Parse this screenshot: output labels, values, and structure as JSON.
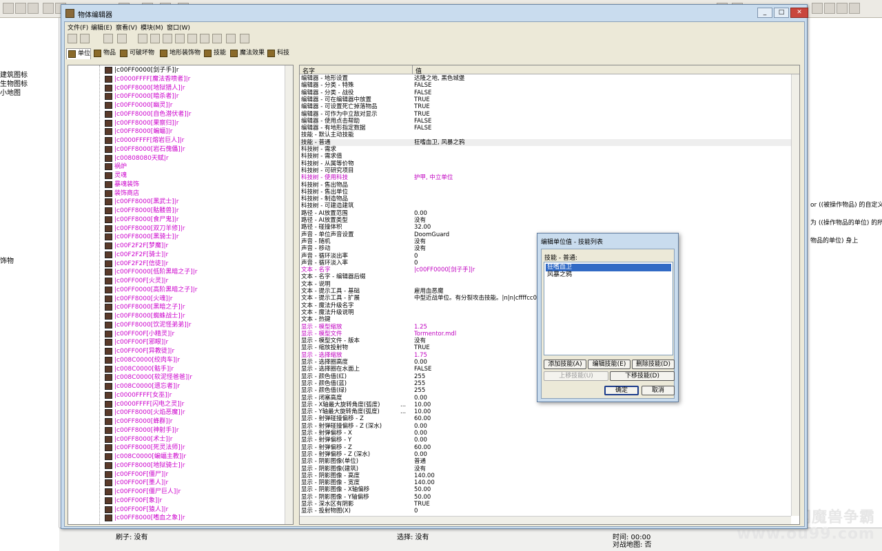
{
  "window": {
    "title": "物体编辑器"
  },
  "menu": [
    "文件(F)",
    "编辑(E)",
    "察看(V)",
    "模块(M)",
    "窗口(W)"
  ],
  "tabs": [
    "单位",
    "物品",
    "可破坏物",
    "地形装饰物",
    "技能",
    "魔法效果",
    "科技"
  ],
  "background": {
    "left_texts": [
      "建筑图标",
      "生物图标",
      "小地图",
      "饰物"
    ],
    "right_texts": [
      "or ((被操作物品) 的自定义",
      "为 ((操作物品的单位) 的所",
      "物品的单位) 身上"
    ],
    "status": {
      "brush": "刷子: 没有",
      "select": "选择: 没有",
      "time": "时间: 00:00",
      "map": "对战地图: 否"
    }
  },
  "watermark": {
    "line1": "偶久网魔兽争霸",
    "line2": "www.ou99.com"
  },
  "tree": [
    {
      "label": "|c00FF0000[剑子手]|r",
      "color": "#000000"
    },
    {
      "label": "|c0000FFFF[魔法香喷者]|r",
      "color": "#cc00cc"
    },
    {
      "label": "|c00FF8000[地狱猎人]|r",
      "color": "#cc00cc"
    },
    {
      "label": "|c00FF0000[暗杀者]|r",
      "color": "#cc00cc"
    },
    {
      "label": "|c00FF0000[幽灵]|r",
      "color": "#cc00cc"
    },
    {
      "label": "|c00FF8000[自色潜伏者]|r",
      "color": "#cc00cc"
    },
    {
      "label": "|c00FF8000[果察归]|r",
      "color": "#cc00cc"
    },
    {
      "label": "|c00FF8000[蝙蝠]|r",
      "color": "#cc00cc"
    },
    {
      "label": "|c0000FFFF[熔岩巨人]|r",
      "color": "#cc00cc"
    },
    {
      "label": "|c00FF8000[岩石傀儡]|r",
      "color": "#cc00cc"
    },
    {
      "label": "|c00808080天赋|r",
      "color": "#cc00cc"
    },
    {
      "label": "祸炉",
      "color": "#cc00cc"
    },
    {
      "label": "灵魂",
      "color": "#cc00cc"
    },
    {
      "label": "暴魂装饰",
      "color": "#cc00cc"
    },
    {
      "label": "装饰商店",
      "color": "#cc00cc"
    },
    {
      "label": "|c00FF8000[黑武士]|r",
      "color": "#cc00cc"
    },
    {
      "label": "|c00FF8000[骷髅兽]|r",
      "color": "#cc00cc"
    },
    {
      "label": "|c00FF8000[食尸鬼]|r",
      "color": "#cc00cc"
    },
    {
      "label": "|c00FF8000[双刀羊修]|r",
      "color": "#cc00cc"
    },
    {
      "label": "|c00FF8000[黑骑士]|r",
      "color": "#cc00cc"
    },
    {
      "label": "|c00F2F2F[梦魔]|r",
      "color": "#cc00cc"
    },
    {
      "label": "|c00F2F2F[骑士]|r",
      "color": "#cc00cc"
    },
    {
      "label": "|c00F2F2F[信徒]|r",
      "color": "#cc00cc"
    },
    {
      "label": "|c00FF0000[低阶黑暗之子]|r",
      "color": "#cc00cc"
    },
    {
      "label": "|c00FF00F[火灵]|r",
      "color": "#cc00cc"
    },
    {
      "label": "|c00FF0000[高阶黑暗之子]|r",
      "color": "#cc00cc"
    },
    {
      "label": "|c00FF8000[火魂]|r",
      "color": "#cc00cc"
    },
    {
      "label": "|c00FF8000[黑暗之子]|r",
      "color": "#cc00cc"
    },
    {
      "label": "|c00FF8000[蜘蛛战士]|r",
      "color": "#cc00cc"
    },
    {
      "label": "|c00FF8000[饮泥怪弟弟]|r",
      "color": "#cc00cc"
    },
    {
      "label": "|c00FF00F[小精灵]|r",
      "color": "#cc00cc"
    },
    {
      "label": "|c00FF00F[邪眼]|r",
      "color": "#cc00cc"
    },
    {
      "label": "|c00FF00F[异教徒]|r",
      "color": "#cc00cc"
    },
    {
      "label": "|c008C0000[绞肉车]|r",
      "color": "#cc00cc"
    },
    {
      "label": "|c008C0000[骷手]|r",
      "color": "#cc00cc"
    },
    {
      "label": "|c008C0000[软泥怪爸爸]|r",
      "color": "#cc00cc"
    },
    {
      "label": "|c008C0000[遗忘者]|r",
      "color": "#cc00cc"
    },
    {
      "label": "|c0000FFFF[女巫]|r",
      "color": "#cc00cc"
    },
    {
      "label": "|c0000FFFF[闪电之灵]|r",
      "color": "#cc00cc"
    },
    {
      "label": "|c00FF8000[火焰恶魔]|r",
      "color": "#cc00cc"
    },
    {
      "label": "|c00FF8000[蜂群]|r",
      "color": "#cc00cc"
    },
    {
      "label": "|c00FF8000[神射手]|r",
      "color": "#cc00cc"
    },
    {
      "label": "|c00FF8000[术士]|r",
      "color": "#cc00cc"
    },
    {
      "label": "|c00FF8000[死灵法师]|r",
      "color": "#cc00cc"
    },
    {
      "label": "|c008C0000[蝙蝠主教]|r",
      "color": "#cc00cc"
    },
    {
      "label": "|c00FF8000[地狱骑士]|r",
      "color": "#cc00cc"
    },
    {
      "label": "|c00FF00F[僵尸]|r",
      "color": "#cc00cc"
    },
    {
      "label": "|c00FF00F[墨人]|r",
      "color": "#cc00cc"
    },
    {
      "label": "|c00FF00F[僵尸巨人]|r",
      "color": "#cc00cc"
    },
    {
      "label": "|c00FF00F[象]|r",
      "color": "#cc00cc"
    },
    {
      "label": "|c00FF00F[猿人]|r",
      "color": "#cc00cc"
    },
    {
      "label": "|c00FF8000[嗜血之象]|r",
      "color": "#cc00cc"
    }
  ],
  "grid": {
    "col_name": "名字",
    "col_value": "值",
    "rows": [
      {
        "k": "编辑器 - 地形设置",
        "v": "达隆之地, 黑色城堡"
      },
      {
        "k": "编辑器 - 分类 - 特殊",
        "v": "FALSE"
      },
      {
        "k": "编辑器 - 分类 - 战役",
        "v": "FALSE"
      },
      {
        "k": "编辑器 - 可在编辑器中放置",
        "v": "TRUE"
      },
      {
        "k": "编辑器 - 可设置死亡掉落物品",
        "v": "TRUE"
      },
      {
        "k": "编辑器 - 可作为中立敌对显示",
        "v": "TRUE"
      },
      {
        "k": "编辑器 - 使用点击帮助",
        "v": "FALSE"
      },
      {
        "k": "编辑器 - 有地形指定数据",
        "v": "FALSE"
      },
      {
        "k": "技能 - 默认主动技能",
        "v": ""
      },
      {
        "k": "技能 - 普通",
        "v": "狂嗜血卫, 风暴之鸦",
        "hl": true
      },
      {
        "k": "科技树 - 需求",
        "v": ""
      },
      {
        "k": "科技树 - 需求值",
        "v": ""
      },
      {
        "k": "科技树 - 从属等价物",
        "v": ""
      },
      {
        "k": "科技树 - 可研究项目",
        "v": ""
      },
      {
        "k": "科技树 - 使用科技",
        "v": "护甲, 中立单位",
        "mag": true
      },
      {
        "k": "科技树 - 售出物品",
        "v": ""
      },
      {
        "k": "科技树 - 售出单位",
        "v": ""
      },
      {
        "k": "科技树 - 制造物品",
        "v": ""
      },
      {
        "k": "科技树 - 可建造建筑",
        "v": ""
      },
      {
        "k": "路径 - AI放置范围",
        "v": "0.00"
      },
      {
        "k": "路径 - AI放置类型",
        "v": "没有"
      },
      {
        "k": "路径 - 碰撞体积",
        "v": "32.00"
      },
      {
        "k": "声音 - 单位声音设置",
        "v": "DoomGuard"
      },
      {
        "k": "声音 - 随机",
        "v": "没有"
      },
      {
        "k": "声音 - 移动",
        "v": "没有"
      },
      {
        "k": "声音 - 循环淡出率",
        "v": "0"
      },
      {
        "k": "声音 - 循环淡入率",
        "v": "0"
      },
      {
        "k": "文本 - 名字",
        "v": "|c00FF0000[剑子手]|r",
        "mag": true
      },
      {
        "k": "文本 - 名字 - 编辑器后缀",
        "v": ""
      },
      {
        "k": "文本 - 说明",
        "v": ""
      },
      {
        "k": "文本 - 提示工具 - 基础",
        "v": "雇用血恶魔"
      },
      {
        "k": "文本 - 提示工具 - 扩展",
        "v": "中型近战单位。有分裂攻击技能。|n|n|cffffcc00"
      },
      {
        "k": "文本 - 魔法升级名字",
        "v": ""
      },
      {
        "k": "文本 - 魔法升级说明",
        "v": ""
      },
      {
        "k": "文本 - 热键",
        "v": ""
      },
      {
        "k": "显示 - 模型缩放",
        "v": "1.25",
        "mag": true
      },
      {
        "k": "显示 - 模型文件",
        "v": "Tormentor.mdl",
        "mag": true
      },
      {
        "k": "显示 - 模型文件 - 版本",
        "v": "没有"
      },
      {
        "k": "显示 - 缩放投射物",
        "v": "TRUE"
      },
      {
        "k": "显示 - 选择缩放",
        "v": "1.75",
        "mag": true
      },
      {
        "k": "显示 - 选择圈高度",
        "v": "0.00"
      },
      {
        "k": "显示 - 选择圈在水面上",
        "v": "FALSE"
      },
      {
        "k": "显示 - 颜色值(红)",
        "v": "255"
      },
      {
        "k": "显示 - 颜色值(蓝)",
        "v": "255"
      },
      {
        "k": "显示 - 颜色值(绿)",
        "v": "255"
      },
      {
        "k": "显示 - 闭塞高度",
        "v": "0.00"
      },
      {
        "k": "显示 - X轴最大旋转角度(弧度)",
        "v": "10.00",
        "dots": true
      },
      {
        "k": "显示 - Y轴最大旋转角度(弧度)",
        "v": "10.00",
        "dots": true
      },
      {
        "k": "显示 - 射弹碰撞偏移 - Z",
        "v": "60.00"
      },
      {
        "k": "显示 - 射弹碰撞偏移 - Z (深水)",
        "v": "0.00"
      },
      {
        "k": "显示 - 射弹偏移 - X",
        "v": "0.00"
      },
      {
        "k": "显示 - 射弹偏移 - Y",
        "v": "0.00"
      },
      {
        "k": "显示 - 射弹偏移 - Z",
        "v": "60.00"
      },
      {
        "k": "显示 - 射弹偏移 - Z (深水)",
        "v": "0.00"
      },
      {
        "k": "显示 - 阴影图像(单位)",
        "v": "普通"
      },
      {
        "k": "显示 - 阴影图像(建筑)",
        "v": "没有"
      },
      {
        "k": "显示 - 阴影图像 - 高度",
        "v": "140.00"
      },
      {
        "k": "显示 - 阴影图像 - 宽度",
        "v": "140.00"
      },
      {
        "k": "显示 - 阴影图像 - X轴偏移",
        "v": "50.00"
      },
      {
        "k": "显示 - 阴影图像 - Y轴偏移",
        "v": "50.00"
      },
      {
        "k": "显示 - 深水区有阴影",
        "v": "TRUE"
      },
      {
        "k": "显示 - 投射物图(X)",
        "v": "0"
      }
    ]
  },
  "dialog": {
    "title": "编辑单位值 - 技能列表",
    "label": "技能 - 普通:",
    "items": [
      "狂嗜血卫",
      "风暴之鸦"
    ],
    "selected": 0,
    "btn_add": "添加技能(A)",
    "btn_edit": "编辑技能(E)",
    "btn_delete": "删除技能(D)",
    "btn_up": "上移技能(U)",
    "btn_down": "下移技能(D)",
    "btn_ok": "确定",
    "btn_cancel": "取消"
  }
}
